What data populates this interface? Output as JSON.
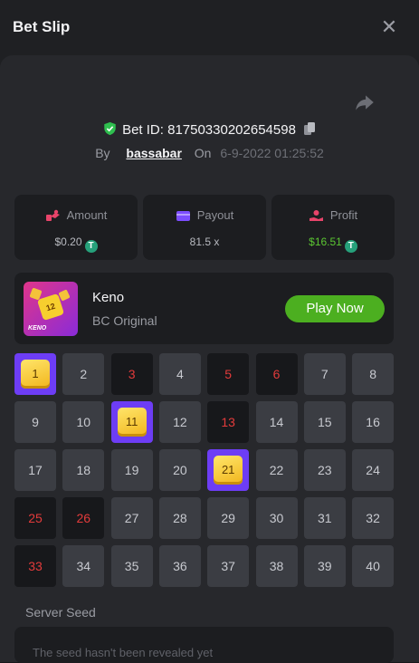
{
  "header": {
    "title": "Bet Slip"
  },
  "bet": {
    "id_label": "Bet ID: 81750330202654598",
    "by_label": "By",
    "user": "bassabar",
    "on_label": "On",
    "date": "6-9-2022 01:25:52"
  },
  "stats": {
    "amount": {
      "label": "Amount",
      "value": "$0.20"
    },
    "payout": {
      "label": "Payout",
      "value": "81.5 x"
    },
    "profit": {
      "label": "Profit",
      "value": "$16.51"
    }
  },
  "currency_icon": "T",
  "game": {
    "name": "Keno",
    "subtitle": "BC Original",
    "thumb_number": "12",
    "thumb_label": "KENO",
    "play_label": "Play Now"
  },
  "keno": {
    "numbers": [
      "1",
      "2",
      "3",
      "4",
      "5",
      "6",
      "7",
      "8",
      "9",
      "10",
      "11",
      "12",
      "13",
      "14",
      "15",
      "16",
      "17",
      "18",
      "19",
      "20",
      "21",
      "22",
      "23",
      "24",
      "25",
      "26",
      "27",
      "28",
      "29",
      "30",
      "31",
      "32",
      "33",
      "34",
      "35",
      "36",
      "37",
      "38",
      "39",
      "40"
    ],
    "hits": [
      1,
      11,
      21
    ],
    "drawn_misses": [
      3,
      5,
      6,
      13,
      25,
      26,
      33
    ]
  },
  "seed": {
    "label": "Server Seed",
    "text": "The seed hasn't been revealed yet"
  },
  "colors": {
    "accent_green": "#4caf20",
    "hit_purple": "#6d3df5",
    "miss_red": "#e33b3b"
  }
}
